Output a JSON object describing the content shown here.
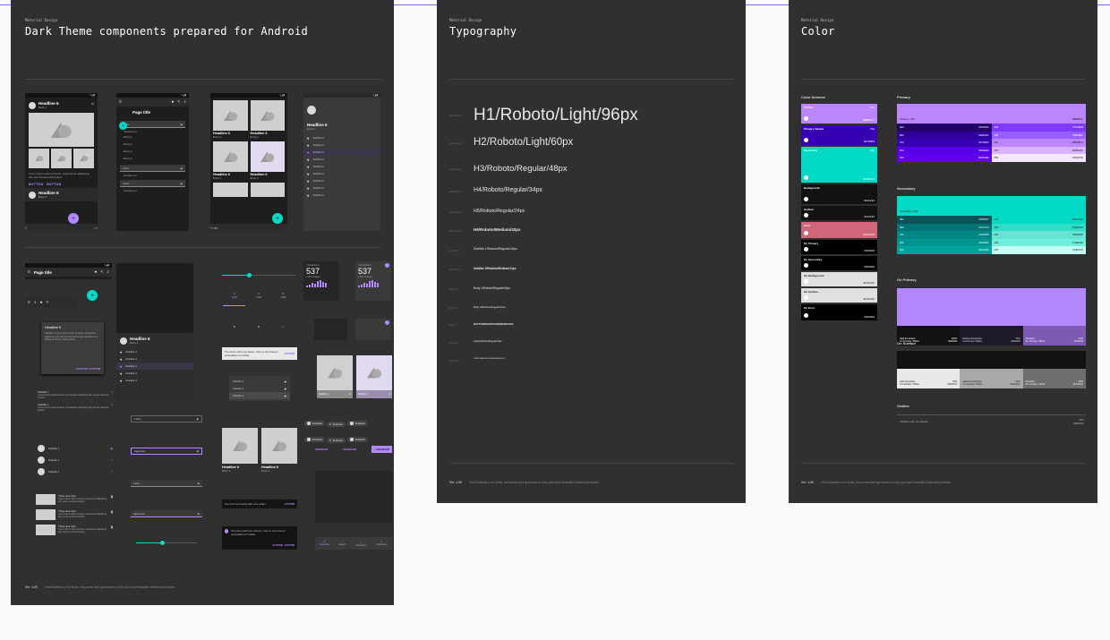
{
  "colors": {
    "background": "#fafafa",
    "board": "#303030",
    "primary": "#b388ff",
    "secondary": "#03dac5",
    "error": "#cf6679"
  },
  "board1": {
    "eyebrow": "Material Design",
    "title": "Dark Theme components prepared for Android",
    "footer_ver": "Ver. 1.00",
    "footer_text": "Visit Material.io for tools, resources and guidance to help you build beautiful Material products.",
    "phones": {
      "headline": "Headline 6",
      "body2": "Body 2",
      "page_title": "Page title",
      "label": "Label",
      "assistive": "Assistive text",
      "body_items": [
        "Body 2",
        "Body 2",
        "Body 2",
        "Body 2"
      ],
      "subtitle": "Subtitle 2",
      "button": "BUTTON",
      "lorem": "Lorem ipsum dolor sit amet, consectetur adipiscing elit, sed do eiusmod tempor."
    },
    "dialog": {
      "title": "Headline 6",
      "body": "Subtitle 1 Lorem ipsum dolor sit amet, consectetur adipiscing elit, sed do eiusmod tempor incididunt ut labore et dolore magna aliqua.",
      "btn1": "BUTTON",
      "btn2": "BUTTON"
    },
    "subtitle1": "Subtitle 1",
    "three_line": "Three-line item",
    "tab": "TAB",
    "stats": {
      "title1": "Connections",
      "value1": "537",
      "sub1": "+12% of target",
      "title2": "Connections",
      "value2": "537",
      "sub2": "+12% of target"
    },
    "snack1": {
      "text": "Two lines with one action. One to two lines is preferable on mobile.",
      "action": "ACTION"
    },
    "snack2": {
      "text": "One line text string with one action.",
      "action": "ACTION"
    },
    "snack3": {
      "text": "Two lines with two actions. One to two lines is preferable on mobile.",
      "action1": "ACTION",
      "action2": "ACTION"
    },
    "chips": {
      "enabled": "Enabled"
    },
    "buttons": {
      "b1": "ENABLED",
      "b2": "ENABLED",
      "b3": "+ ENABLED"
    },
    "input_text": "Input text",
    "bottom_nav": [
      "Favorites",
      "Search",
      "Information",
      "Notification"
    ]
  },
  "board2": {
    "eyebrow": "Material Design",
    "title": "Typography",
    "footer_ver": "Ver. 1.00",
    "footer_text": "Visit Material.io for tools, resources and guidance to help you build beautiful Material products.",
    "styles": [
      {
        "label": "Headline 1",
        "text": "H1/Roboto/Light/96px"
      },
      {
        "label": "Headline 2",
        "text": "H2/Roboto/Light/60px"
      },
      {
        "label": "Headline 3",
        "text": "H3/Roboto/Regular/48px"
      },
      {
        "label": "Headline 4",
        "text": "H4/Roboto/Regular/34px"
      },
      {
        "label": "Headline 5",
        "text": "H5/Roboto/Regular/24px"
      },
      {
        "label": "Headline 6",
        "text": "H6/Roboto/Medium/20px"
      },
      {
        "label": "Subtitle 1",
        "text": "Subtitle 1/Roboto/Regular/16px"
      },
      {
        "label": "Subtitle 2",
        "text": "Subtitle 2/Roboto/Medium/14px"
      },
      {
        "label": "Body 1",
        "text": "Body 1/Roboto/Regular/16px"
      },
      {
        "label": "Body 2",
        "text": "Body 2/Roboto/Regular/14px"
      },
      {
        "label": "Button",
        "text": "BUTTON/ROBOTO/MEDIUM/14PX"
      },
      {
        "label": "Caption",
        "text": "Caption/Roboto/Regular/12px"
      },
      {
        "label": "Overline",
        "text": "OVERLINE/ROBOTO/REGULAR/10PX"
      }
    ]
  },
  "board3": {
    "eyebrow": "Material Design",
    "title": "Color",
    "footer_ver": "Ver. 1.00",
    "footer_text": "Visit Material.io for tools, resources and guidance to help you build beautiful Material products.",
    "scheme_title": "Color Scheme",
    "scheme": [
      {
        "name": "Primary",
        "tone": "200",
        "hex": "#BB86FC",
        "color": "#bb86fc"
      },
      {
        "name": "Primary Variant",
        "tone": "700",
        "hex": "#3700B3",
        "color": "#3700b3"
      },
      {
        "name": "Secondary",
        "tone": "200",
        "hex": "#03DAC6",
        "color": "#03dac6"
      },
      {
        "name": "Background",
        "tone": "",
        "hex": "#121212",
        "color": "#121212"
      },
      {
        "name": "Surface",
        "tone": "",
        "hex": "#121212",
        "color": "#121212"
      },
      {
        "name": "Error",
        "tone": "",
        "hex": "#CF6679",
        "color": "#cf6679"
      },
      {
        "name": "On Primary",
        "tone": "",
        "hex": "#000000",
        "color": "#000000"
      },
      {
        "name": "On Secondary",
        "tone": "",
        "hex": "#000000",
        "color": "#000000"
      },
      {
        "name": "On Background",
        "tone": "",
        "hex": "#FFFFFF",
        "color": "#e0e0e0"
      },
      {
        "name": "On Surface",
        "tone": "",
        "hex": "#FFFFFF",
        "color": "#e0e0e0"
      },
      {
        "name": "On Error",
        "tone": "",
        "hex": "#000000",
        "color": "#000000"
      }
    ],
    "primary_title": "Primary",
    "primary_header": {
      "label": "Primary / 200",
      "hex": "#BB86FC"
    },
    "primary_cells": [
      {
        "t": "900",
        "h": "#23036A",
        "c": "#23036a"
      },
      {
        "t": "400",
        "h": "#7F39FB",
        "c": "#7f39fb"
      },
      {
        "t": "800",
        "h": "#30009C",
        "c": "#30009c"
      },
      {
        "t": "300",
        "h": "#985EFF",
        "c": "#985eff"
      },
      {
        "t": "700",
        "h": "#3700B3",
        "c": "#3700b3"
      },
      {
        "t": "200",
        "h": "#BB86FC",
        "c": "#bb86fc"
      },
      {
        "t": "600",
        "h": "#5600E8",
        "c": "#5600e8"
      },
      {
        "t": "100",
        "h": "#DBB2FF",
        "c": "#dbb2ff"
      },
      {
        "t": "500",
        "h": "#6200EE",
        "c": "#6200ee"
      },
      {
        "t": "050",
        "h": "#F2E7FE",
        "c": "#f2e7fe"
      }
    ],
    "secondary_title": "Secondary",
    "secondary_header": {
      "label": "Secondary / 200"
    },
    "secondary_cells": [
      {
        "t": "900",
        "h": "#005457",
        "c": "#005457"
      },
      {
        "t": "400",
        "h": "#03DAC5",
        "c": "#03dac5"
      },
      {
        "t": "800",
        "h": "#017374",
        "c": "#017374"
      },
      {
        "t": "300",
        "h": "#30DDC9",
        "c": "#30ddc9"
      },
      {
        "t": "700",
        "h": "#018786",
        "c": "#018786"
      },
      {
        "t": "200",
        "h": "#66E5D6",
        "c": "#66e5d6"
      },
      {
        "t": "600",
        "h": "#019592",
        "c": "#019592"
      },
      {
        "t": "100",
        "h": "#70EFDE",
        "c": "#70efde"
      },
      {
        "t": "500",
        "h": "#01A299",
        "c": "#01a299"
      },
      {
        "t": "050",
        "h": "#C8FFF4",
        "c": "#c8fff4"
      }
    ],
    "on_primary_title": "On Primary",
    "on_primary": [
      {
        "l1": "High Emphasis",
        "l2": "On Primary / Black",
        "p": "100%",
        "h": "#000000"
      },
      {
        "l1": "Medium Emphasis",
        "l2": "On Primary / Black",
        "p": "74%",
        "h": "#000000"
      },
      {
        "l1": "Disabled",
        "l2": "On Primary / Black",
        "p": "38%",
        "h": "#000000"
      }
    ],
    "on_surface_title": "On Surface",
    "on_surface": [
      {
        "l1": "High Emphasis",
        "l2": "On Surface / White",
        "p": "87%",
        "h": "#FFFFFF"
      },
      {
        "l1": "Medium Emphasis",
        "l2": "On Surface / White",
        "p": "60%",
        "h": "#FFFFFF"
      },
      {
        "l1": "Disabled",
        "l2": "On Surface / White",
        "p": "38%",
        "h": "#FFFFFF"
      }
    ],
    "outline_title": "Outline",
    "outline_row": {
      "label": "↑ Border color: On surface",
      "p": "12%",
      "h": "#FFFFFF"
    }
  }
}
